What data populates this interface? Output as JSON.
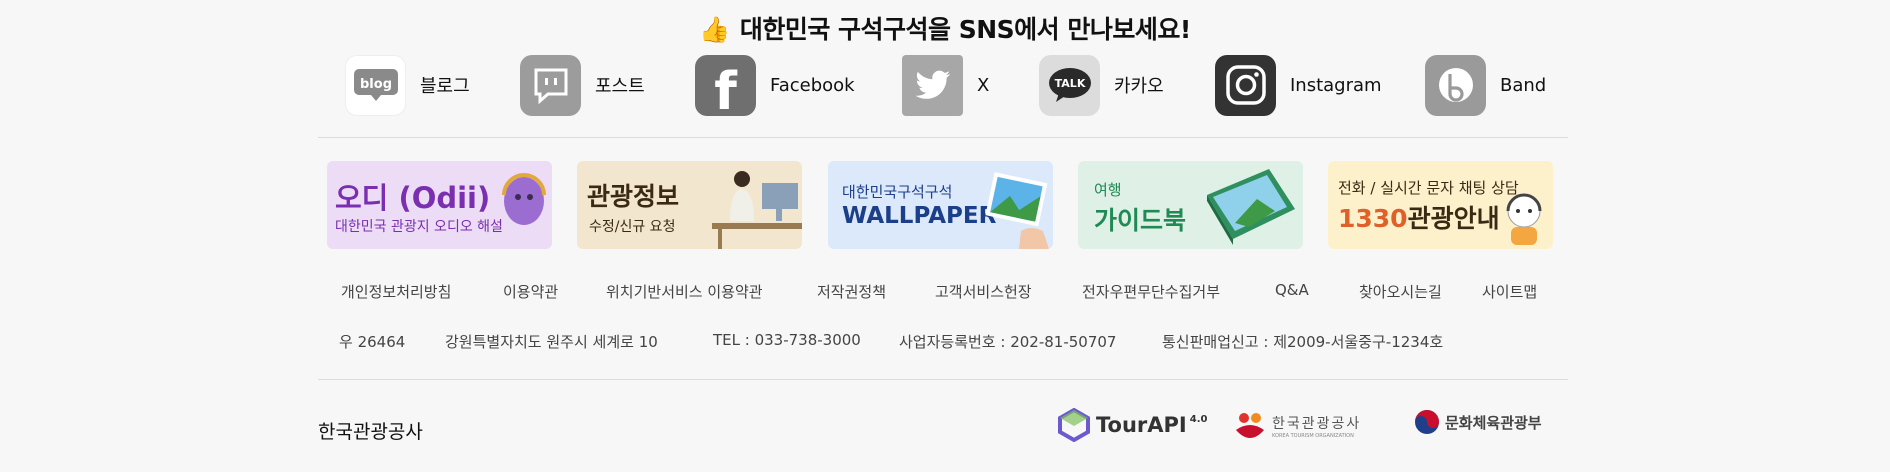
{
  "sns": {
    "title": "대한민국 구석구석을 SNS에서 만나보세요!",
    "thumb_emoji": "👍",
    "items": [
      {
        "label": "블로그",
        "icon": "blog-icon",
        "icon_text": "blog"
      },
      {
        "label": "포스트",
        "icon": "post-icon"
      },
      {
        "label": "Facebook",
        "icon": "facebook-icon",
        "icon_text": "f"
      },
      {
        "label": "X",
        "icon": "twitter-icon"
      },
      {
        "label": "카카오",
        "icon": "kakao-talk-icon",
        "icon_text": "TALK"
      },
      {
        "label": "Instagram",
        "icon": "instagram-icon"
      },
      {
        "label": "Band",
        "icon": "band-icon",
        "icon_text": "b"
      }
    ]
  },
  "banners": [
    {
      "line1": "오디 (Odii)",
      "line2": "대한민국 관광지 오디오 해설",
      "bg": "#ecdcf5",
      "color": "#7a2fb0"
    },
    {
      "line1": "관광정보",
      "line2": "수정/신규 요청",
      "bg": "#f3e6cf",
      "color": "#3a2a14"
    },
    {
      "line1": "대한민국구석구석",
      "line2": "WALLPAPER",
      "bg": "#dce9fb",
      "color": "#1c3f8a"
    },
    {
      "line1": "여행",
      "line2": "가이드북",
      "bg": "#dff1e7",
      "color": "#1f8a52"
    },
    {
      "line1": "전화 / 실시간 문자 채팅 상담",
      "line2_num": "1330",
      "line2": "관광안내",
      "bg": "#fdf1cc",
      "color": "#3a2a14"
    }
  ],
  "footer_links": [
    "개인정보처리방침",
    "이용약관",
    "위치기반서비스 이용약관",
    "저작권정책",
    "고객서비스헌장",
    "전자우편무단수집거부",
    "Q&A",
    "찾아오시는길",
    "사이트맵"
  ],
  "address": {
    "postcode": "우 26464",
    "street": "강원특별자치도 원주시 세계로 10",
    "tel": "TEL : 033-738-3000",
    "business_no": "사업자등록번호 : 202-81-50707",
    "mail_order": "통신판매업신고 : 제2009-서울중구-1234호"
  },
  "org_name": "한국관광공사",
  "partner_logos": {
    "tourapi": "TourAPI",
    "tourapi_version": "4.0",
    "kto": "한국관광공사",
    "kto_sub": "KOREA TOURISM ORGANIZATION",
    "mcst": "문화체육관광부"
  }
}
